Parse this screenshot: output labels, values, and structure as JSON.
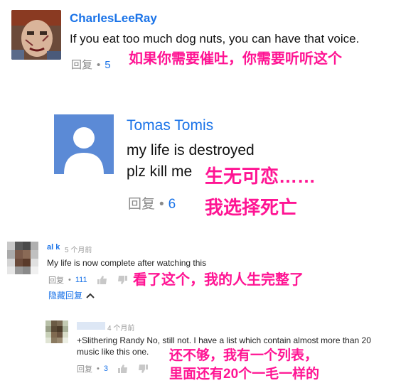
{
  "colors": {
    "link": "#1a73e8",
    "annotation": "#ff1493",
    "muted": "#8a8a8a",
    "text": "#111111"
  },
  "comments": [
    {
      "author": "CharlesLeeRay",
      "text": "If you eat too much dog nuts, you can have that voice.",
      "reply_label": "回复",
      "separator": "•",
      "reply_count": "5",
      "annotation": "如果你需要催吐，你需要听听这个",
      "avatar_icon": "horror-doll-avatar"
    },
    {
      "author": "Tomas Tomis",
      "text_line1": "my life is destroyed",
      "text_line2": "plz kill me",
      "reply_label": "回复",
      "separator": "•",
      "reply_count": "6",
      "annotation_line1": "生无可恋……",
      "annotation_line2": "我选择死亡",
      "avatar_icon": "default-person-avatar"
    },
    {
      "author": "al k",
      "time": "5 个月前",
      "text": "My life is now complete after watching this",
      "reply_label": "回复",
      "separator": "•",
      "reply_count": "111",
      "annotation": "看了这个，我的人生完整了",
      "hide_replies": "隐藏回复",
      "avatar_icon": "pixelated-avatar"
    },
    {
      "time": "4 个月前",
      "text_line1": "+Slithering Randy No, still not. I have a list which contain almost more than 20",
      "text_line2": "music like this one.",
      "reply_label": "回复",
      "separator": "•",
      "reply_count": "3",
      "annotation_line1": "还不够，我有一个列表，",
      "annotation_line2": "里面还有20个一毛一样的",
      "avatar_icon": "pixelated-avatar"
    }
  ]
}
